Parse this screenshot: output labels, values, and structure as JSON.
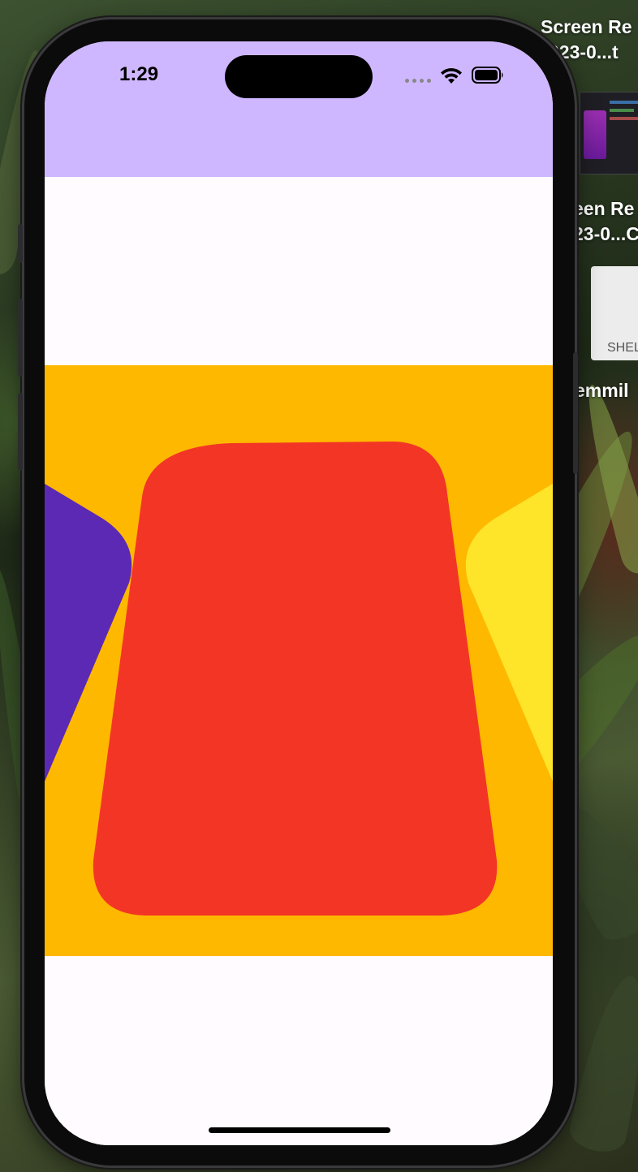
{
  "status_bar": {
    "time": "1:29"
  },
  "app": {
    "colors": {
      "top_bar": "#cfb7ff",
      "background": "#fffbfe",
      "carousel_background": "#ffb800",
      "card_left": "#5b29b4",
      "card_center": "#f33526",
      "card_right": "#ffe52a"
    }
  },
  "desktop": {
    "files": [
      {
        "line1": "Screen Re",
        "line2": "023-0...t"
      },
      {
        "line1": "een Re",
        "line2": "23-0...C",
        "thumb_text": "SHEL"
      },
      {
        "line1": "emmil"
      }
    ]
  }
}
